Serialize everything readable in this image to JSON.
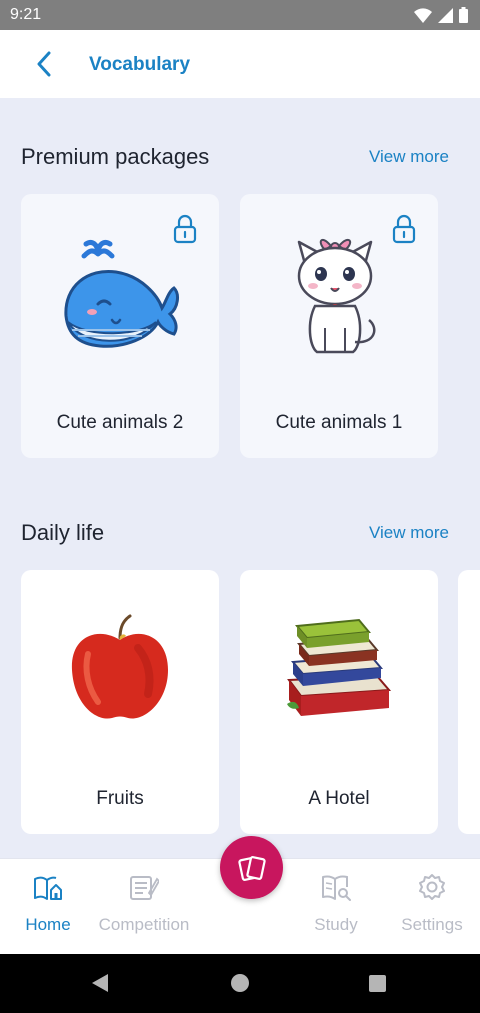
{
  "status_bar": {
    "time": "9:21"
  },
  "app_bar": {
    "title": "Vocabulary"
  },
  "premium": {
    "title": "Premium packages",
    "view_more": "View more",
    "cards": [
      {
        "label": "Cute animals 2",
        "image": "whale",
        "locked": true
      },
      {
        "label": "Cute animals 1",
        "image": "cat",
        "locked": true
      }
    ]
  },
  "daily": {
    "title": "Daily life",
    "view_more": "View more",
    "cards": [
      {
        "label": "Fruits",
        "image": "apple"
      },
      {
        "label": "A Hotel",
        "image": "books"
      }
    ]
  },
  "bottom_nav": {
    "items": [
      {
        "label": "Home",
        "icon": "home-icon",
        "active": true
      },
      {
        "label": "Competition",
        "icon": "competition-icon",
        "active": false
      },
      {
        "label": "Study",
        "icon": "study-icon",
        "active": false
      },
      {
        "label": "Settings",
        "icon": "settings-icon",
        "active": false
      }
    ]
  },
  "colors": {
    "accent": "#1b82c4",
    "fab": "#c8165e",
    "background": "#e9ecf7"
  }
}
